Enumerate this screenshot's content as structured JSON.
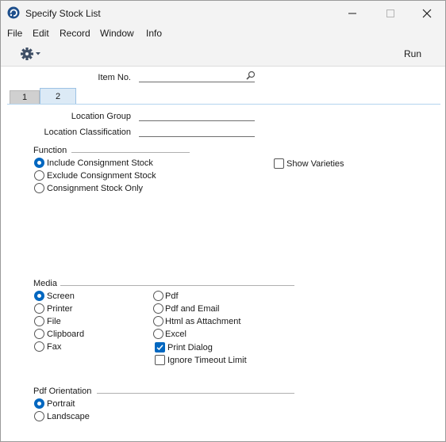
{
  "window": {
    "title": "Specify Stock List"
  },
  "menu": [
    "File",
    "Edit",
    "Record",
    "Window",
    "Info"
  ],
  "toolbar": {
    "run_label": "Run"
  },
  "header": {
    "item_no_label": "Item No.",
    "item_no_value": ""
  },
  "tabs": [
    {
      "label": "1",
      "active": false
    },
    {
      "label": "2",
      "active": true
    }
  ],
  "location": {
    "group_label": "Location Group",
    "group_value": "",
    "classification_label": "Location Classification",
    "classification_value": ""
  },
  "function": {
    "title": "Function",
    "options": [
      {
        "label": "Include Consignment Stock",
        "selected": true
      },
      {
        "label": "Exclude Consignment Stock",
        "selected": false
      },
      {
        "label": "Consignment Stock Only",
        "selected": false
      }
    ]
  },
  "show_varieties": {
    "label": "Show Varieties",
    "checked": false
  },
  "media": {
    "title": "Media",
    "left_options": [
      {
        "label": "Screen",
        "selected": true
      },
      {
        "label": "Printer",
        "selected": false
      },
      {
        "label": "File",
        "selected": false
      },
      {
        "label": "Clipboard",
        "selected": false
      },
      {
        "label": "Fax",
        "selected": false
      }
    ],
    "right_options": [
      {
        "label": "Pdf",
        "selected": false
      },
      {
        "label": "Pdf and Email",
        "selected": false
      },
      {
        "label": "Html as Attachment",
        "selected": false
      },
      {
        "label": "Excel",
        "selected": false
      }
    ],
    "print_dialog": {
      "label": "Print Dialog",
      "checked": true
    },
    "ignore_timeout": {
      "label": "Ignore Timeout Limit",
      "checked": false
    }
  },
  "pdf_orientation": {
    "title": "Pdf Orientation",
    "options": [
      {
        "label": "Portrait",
        "selected": true
      },
      {
        "label": "Landscape",
        "selected": false
      }
    ]
  },
  "colors": {
    "accent": "#0067c0",
    "chrome": "#f3f3f3",
    "tab_active": "#dceaf6"
  }
}
